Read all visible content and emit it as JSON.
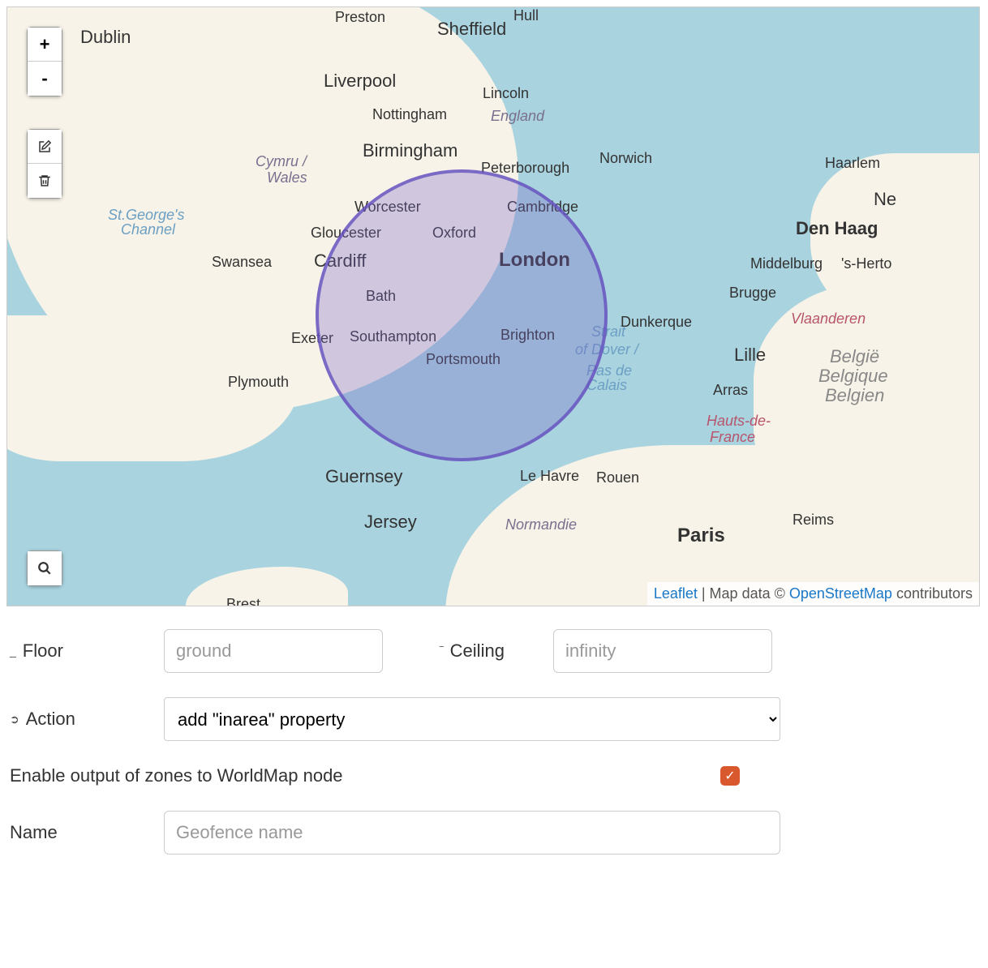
{
  "map": {
    "zoom_in_label": "+",
    "zoom_out_label": "-",
    "leaflet_label": "Leaflet",
    "attribution_prefix": " | Map data © ",
    "osm_label": "OpenStreetMap",
    "attribution_suffix": " contributors",
    "cities": {
      "dublin": "Dublin",
      "preston": "Preston",
      "sheffield": "Sheffield",
      "hull": "Hull",
      "liverpool": "Liverpool",
      "lincoln": "Lincoln",
      "england": "England",
      "nottingham": "Nottingham",
      "birmingham": "Birmingham",
      "peterborough": "Peterborough",
      "norwich": "Norwich",
      "haarlem": "Haarlem",
      "cymru": "Cymru /",
      "wales": "Wales",
      "worcester": "Worcester",
      "cambridge": "Cambridge",
      "ne": "Ne",
      "stgeorge": "St.George's",
      "channel": "Channel",
      "oxford": "Oxford",
      "gloucester": "Gloucester",
      "denhaag": "Den Haag",
      "swansea": "Swansea",
      "cardiff": "Cardiff",
      "london": "London",
      "middelburg": "Middelburg",
      "shert": "'s-Herto",
      "bath": "Bath",
      "brugge": "Brugge",
      "dunkerque": "Dunkerque",
      "vlaand": "Vlaanderen",
      "exeter": "Exeter",
      "southampton": "Southampton",
      "brighton": "Brighton",
      "strait": "Strait",
      "dover": "of Dover /",
      "lille": "Lille",
      "portsmouth": "Portsmouth",
      "pasde": "Pas de",
      "calais": "Calais",
      "belgie": "België",
      "belgiq": "Belgique",
      "belgien": "Belgien",
      "plymouth": "Plymouth",
      "arras": "Arras",
      "hauts": "Hauts-de-",
      "france": "France",
      "guernsey": "Guernsey",
      "lehavre": "Le Havre",
      "rouen": "Rouen",
      "reims": "Reims",
      "jersey": "Jersey",
      "normandie": "Normandie",
      "paris": "Paris",
      "brest": "Brest"
    }
  },
  "form": {
    "floor_label": "Floor",
    "floor_placeholder": "ground",
    "ceiling_label": "Ceiling",
    "ceiling_placeholder": "infinity",
    "action_label": "Action",
    "action_value": "add \"inarea\" property",
    "enable_label": "Enable output of zones to WorldMap node",
    "enable_checked": true,
    "name_label": "Name",
    "name_placeholder": "Geofence name",
    "checkmark": "✓",
    "underscore": "_",
    "bar": "‾"
  }
}
